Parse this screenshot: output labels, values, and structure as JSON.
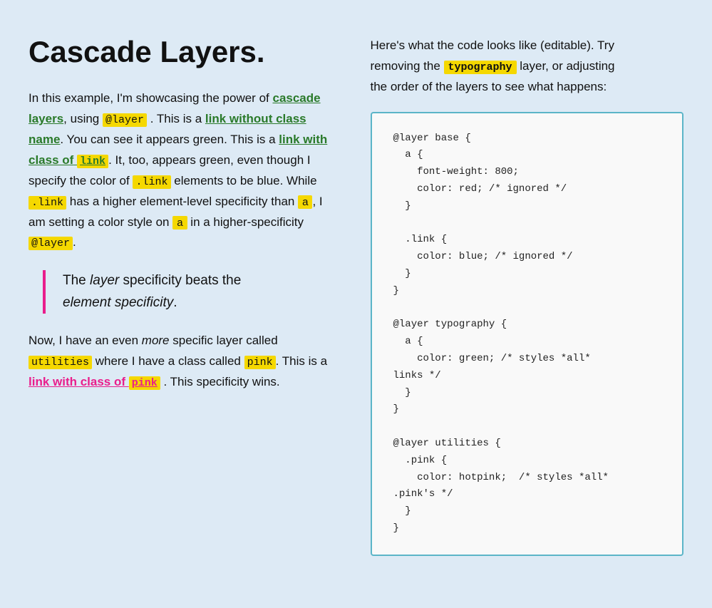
{
  "page": {
    "title": "Cascade Layers.",
    "left": {
      "intro": "In this example, I'm showcasing the power of",
      "cascade_layers_link_text": "cascade layers",
      "using_text": ", using",
      "at_layer_badge": "@layer",
      "this_is_a": ". This is a",
      "link_no_class_text": "link without class name",
      "you_can_see": ". You can see it appears green. This is a",
      "link_with_class_text": "link with class of",
      "link_badge": "link",
      "it_too": ". It, too, appears green, even though I specify the color of",
      "link_badge2": ".link",
      "elements_blue": "elements to be blue. While",
      "link_badge3": ".link",
      "has_higher": "has a higher element-level specificity than",
      "a_badge": "a",
      "i_am_setting": ", I am setting a color style on",
      "a_badge2": "a",
      "in_higher": "in a higher-specificity",
      "at_layer_badge2": "@layer",
      "period": ".",
      "blockquote_line1": "The",
      "blockquote_layer": "layer",
      "blockquote_line1b": "specificity beats the",
      "blockquote_line2": "element specificity",
      "blockquote_period": ".",
      "now_text": "Now, I have an even",
      "more_em": "more",
      "specific_text": "specific layer called",
      "utilities_badge": "utilities",
      "where_text": "where I have a class called",
      "pink_badge": "pink",
      "this_is_a2": ". This is a",
      "pink_link_text": "link with class of",
      "pink_highlight": "pink",
      "this_spec": ". This specificity wins."
    },
    "right": {
      "intro_line1": "Here's what the code looks like (editable). Try",
      "intro_line2": "removing the",
      "typography_highlight": "typography",
      "intro_line3": "layer, or adjusting",
      "intro_line4": "the order of the layers to see what happens:",
      "code": "@layer base {\n  a {\n    font-weight: 800;\n    color: red; /* ignored */\n  }\n\n  .link {\n    color: blue; /* ignored */\n  }\n}\n\n@layer typography {\n  a {\n    color: green; /* styles *all*\nlinks */\n  }\n}\n\n@layer utilities {\n  .pink {\n    color: hotpink;  /* styles *all*\n.pink's */\n  }\n}"
    }
  }
}
